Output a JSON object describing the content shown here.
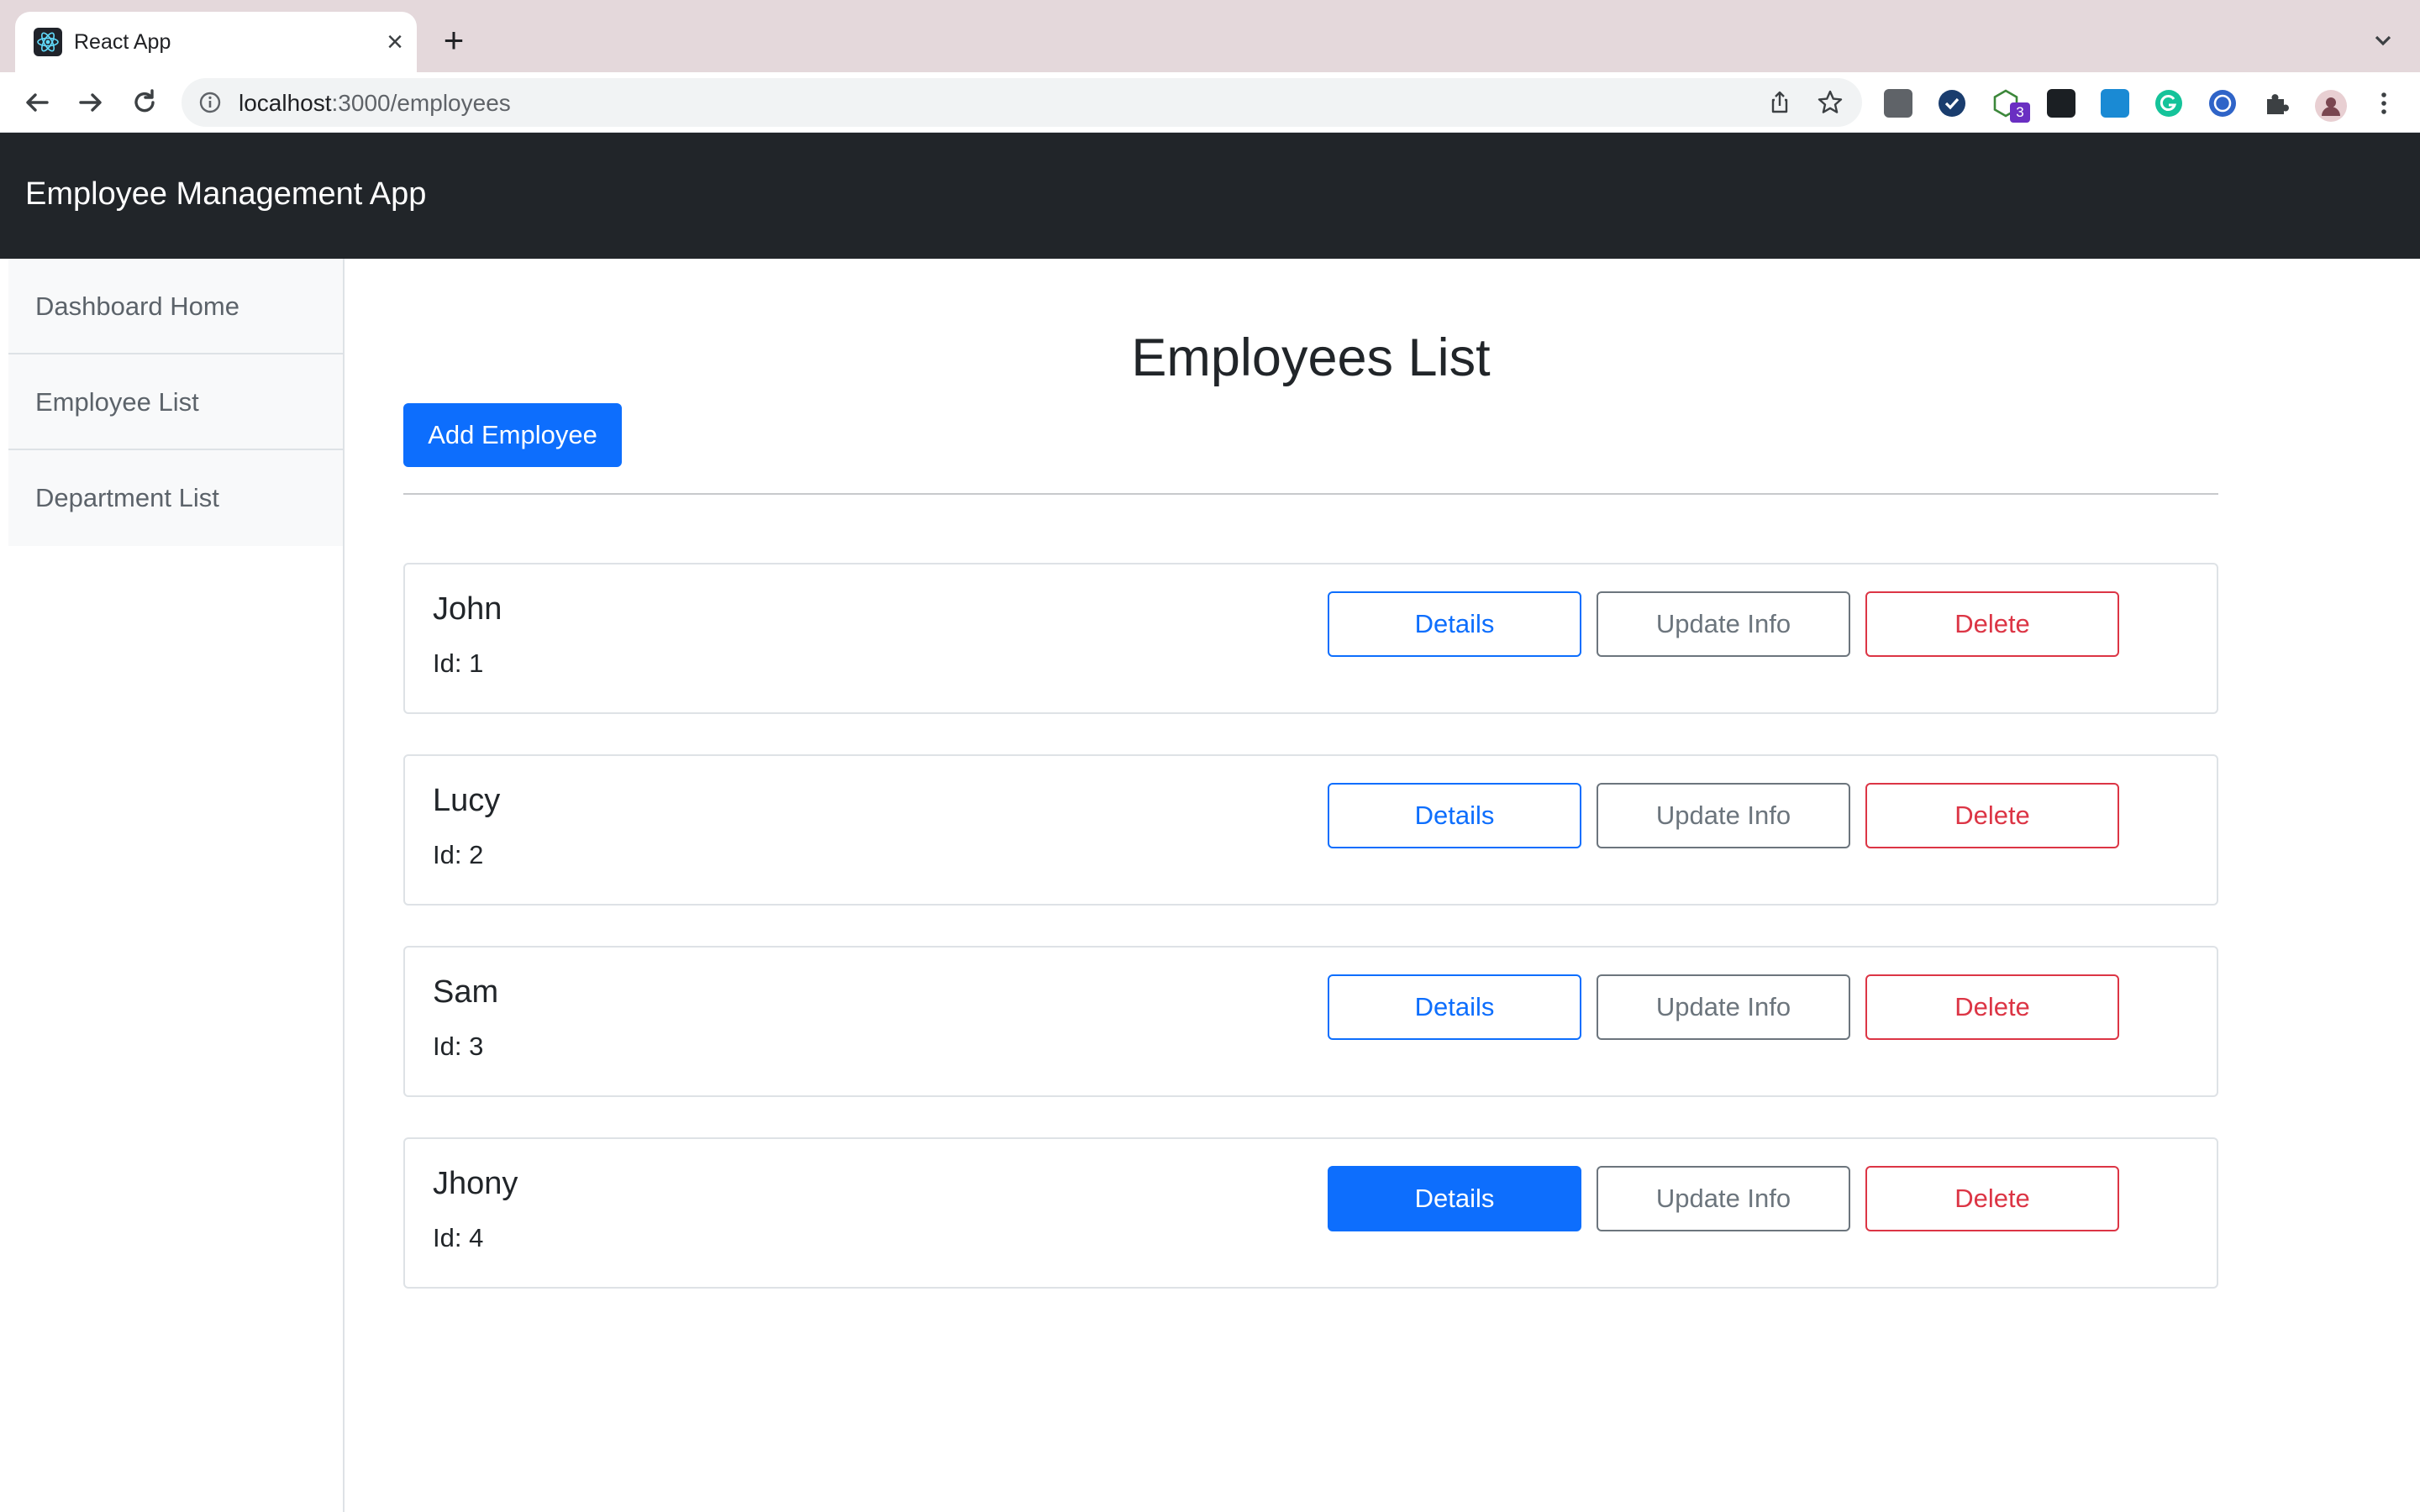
{
  "browser": {
    "tab_title": "React App",
    "close_glyph": "×",
    "new_tab_glyph": "+",
    "url_host": "localhost",
    "url_path": ":3000/employees",
    "extension_badge": "3"
  },
  "app": {
    "brand": "Employee Management App",
    "sidebar": {
      "items": [
        {
          "label": "Dashboard Home"
        },
        {
          "label": "Employee List"
        },
        {
          "label": "Department List"
        }
      ]
    },
    "main": {
      "title": "Employees List",
      "add_button_label": "Add Employee",
      "employees": [
        {
          "name": "John",
          "id_text": "Id: 1",
          "details": "Details",
          "update": "Update Info",
          "delete": "Delete"
        },
        {
          "name": "Lucy",
          "id_text": "Id: 2",
          "details": "Details",
          "update": "Update Info",
          "delete": "Delete"
        },
        {
          "name": "Sam",
          "id_text": "Id: 3",
          "details": "Details",
          "update": "Update Info",
          "delete": "Delete"
        },
        {
          "name": "Jhony",
          "id_text": "Id: 4",
          "details": "Details",
          "update": "Update Info",
          "delete": "Delete"
        }
      ]
    }
  },
  "colors": {
    "primary": "#0d6efd",
    "secondary": "#6c757d",
    "danger": "#dc3545",
    "navbar": "#212529",
    "tabbar": "#e4d8db"
  }
}
